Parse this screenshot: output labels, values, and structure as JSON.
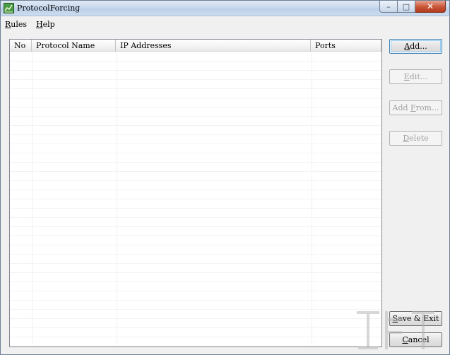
{
  "window": {
    "title": "ProtocolForcing",
    "icon": "app-chart-icon",
    "caption_buttons": {
      "minimize": "–",
      "maximize": "□",
      "close": "✕"
    }
  },
  "menu": {
    "items": [
      {
        "key": "R",
        "rest": "ules"
      },
      {
        "key": "H",
        "rest": "elp"
      }
    ]
  },
  "list": {
    "columns": [
      "No",
      "Protocol Name",
      "IP Addresses",
      "Ports"
    ],
    "rows": []
  },
  "buttons": {
    "add": {
      "key": "A",
      "rest": "dd...",
      "state": "default"
    },
    "edit": {
      "key": "E",
      "rest": "dit...",
      "state": "disabled"
    },
    "add_from": {
      "pre": "Add ",
      "key": "F",
      "rest": "rom...",
      "state": "disabled"
    },
    "delete": {
      "key": "D",
      "rest": "elete",
      "state": "disabled"
    },
    "save_exit": {
      "key": "S",
      "rest": "ave & Exit",
      "state": "normal"
    },
    "cancel": {
      "key": "C",
      "rest": "ancel",
      "state": "normal"
    }
  },
  "colors": {
    "window_bg": "#f0f0f0",
    "list_bg": "#ffffff",
    "disabled_text": "#a0a0a0",
    "default_button_border": "#3c7fb1"
  }
}
